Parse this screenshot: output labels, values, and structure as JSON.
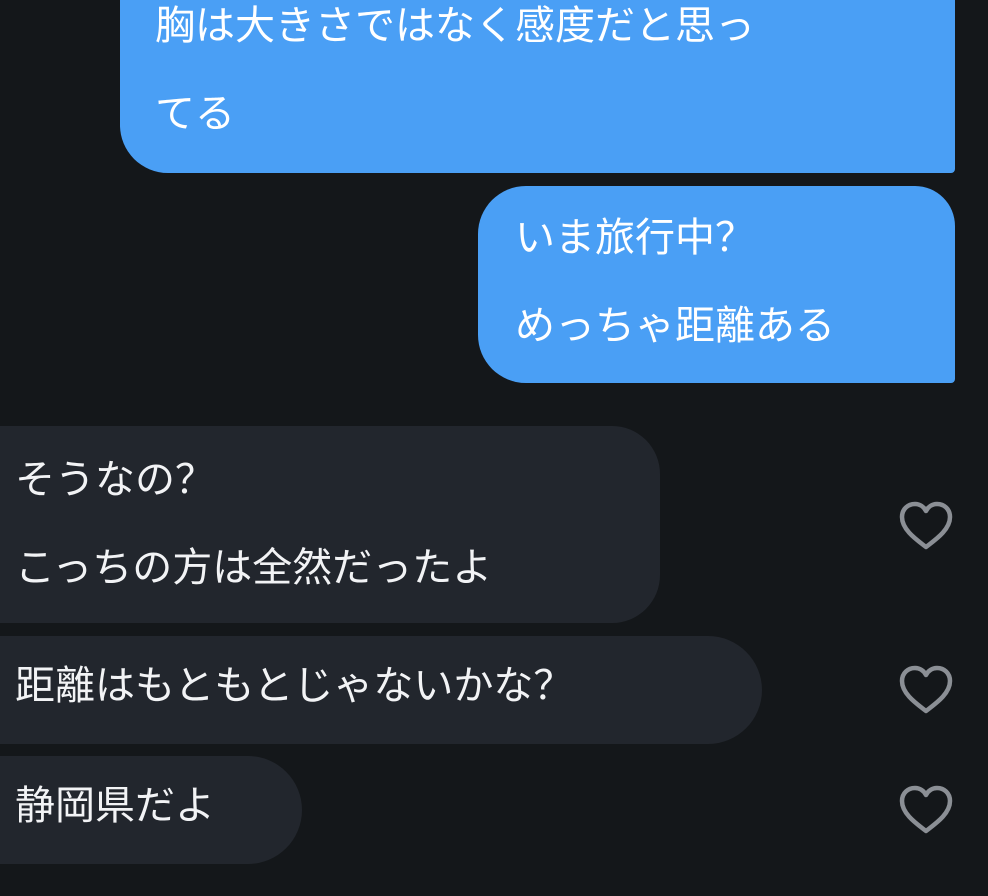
{
  "conversation": {
    "messages": [
      {
        "direction": "sent",
        "lines": [
          "胸は大きさではなく感度だと思っ",
          "てる"
        ]
      },
      {
        "direction": "sent",
        "lines": [
          "いま旅行中？",
          "めっちゃ距離ある"
        ]
      },
      {
        "direction": "received",
        "lines": [
          "そうなの？",
          "こっちの方は全然だったよ"
        ]
      },
      {
        "direction": "received",
        "lines": [
          "距離はもともとじゃないかな？"
        ]
      },
      {
        "direction": "received",
        "lines": [
          "静岡県だよ"
        ]
      }
    ]
  },
  "icons": {
    "like": "heart-outline-icon"
  },
  "colors": {
    "background": "#14171a",
    "sent_bubble": "#4a9ff5",
    "received_bubble": "#22262d",
    "text": "#ffffff",
    "heart_icon": "#8b8f95"
  }
}
